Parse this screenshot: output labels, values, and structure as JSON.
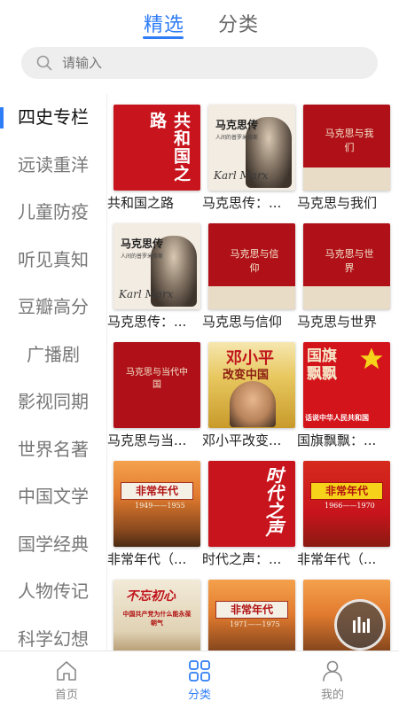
{
  "top_tabs": [
    {
      "label": "精选",
      "active": true
    },
    {
      "label": "分类",
      "active": false
    }
  ],
  "search": {
    "placeholder": "请输入",
    "value": ""
  },
  "sidebar": {
    "items": [
      {
        "label": "四史专栏",
        "active": true
      },
      {
        "label": "远读重洋"
      },
      {
        "label": "儿童防疫"
      },
      {
        "label": "听见真知"
      },
      {
        "label": "豆瓣高分"
      },
      {
        "label": "广播剧"
      },
      {
        "label": "影视同期"
      },
      {
        "label": "世界名著"
      },
      {
        "label": "中国文学"
      },
      {
        "label": "国学经典"
      },
      {
        "label": "人物传记"
      },
      {
        "label": "科学幻想"
      }
    ]
  },
  "books": [
    {
      "title": "共和国之路",
      "cover_text": "共和国之路"
    },
    {
      "title": "马克思传：...",
      "cover_text": "马克思传",
      "cover_sub": "人间的普罗米修斯",
      "signature": "Karl Marx"
    },
    {
      "title": "马克思与我们",
      "cover_text": "马克思与我们"
    },
    {
      "title": "马克思传：...",
      "cover_text": "马克思传",
      "cover_sub": "人间的普罗米修斯",
      "signature": "Karl Marx"
    },
    {
      "title": "马克思与信仰",
      "cover_text": "马克思与信仰"
    },
    {
      "title": "马克思与世界",
      "cover_text": "马克思与世界"
    },
    {
      "title": "马克思与当...",
      "cover_text": "马克思与当代中国"
    },
    {
      "title": "邓小平改变...",
      "cover_text": "邓小平",
      "cover_sub": "改变中国"
    },
    {
      "title": "国旗飘飘：...",
      "cover_text": "国旗飘飘",
      "cover_sub": "话说中华人民共和国"
    },
    {
      "title": "非常年代（...",
      "cover_text": "非常年代",
      "cover_sub": "1949——1955"
    },
    {
      "title": "时代之声：...",
      "cover_text": "时代之声"
    },
    {
      "title": "非常年代（...",
      "cover_text": "非常年代",
      "cover_sub": "1966——1970"
    },
    {
      "title": "",
      "cover_text": "不忘初心",
      "cover_sub": "中国共产党为什么能永葆朝气"
    },
    {
      "title": "",
      "cover_text": "非常年代",
      "cover_sub": "1971——1975"
    },
    {
      "title": "",
      "cover_text": ""
    }
  ],
  "bottom_nav": [
    {
      "label": "首页",
      "icon": "home-icon",
      "active": false
    },
    {
      "label": "分类",
      "icon": "grid-icon",
      "active": true
    },
    {
      "label": "我的",
      "icon": "user-icon",
      "active": false
    }
  ],
  "colors": {
    "accent": "#2f7df6",
    "cover_red": "#c8141c"
  }
}
